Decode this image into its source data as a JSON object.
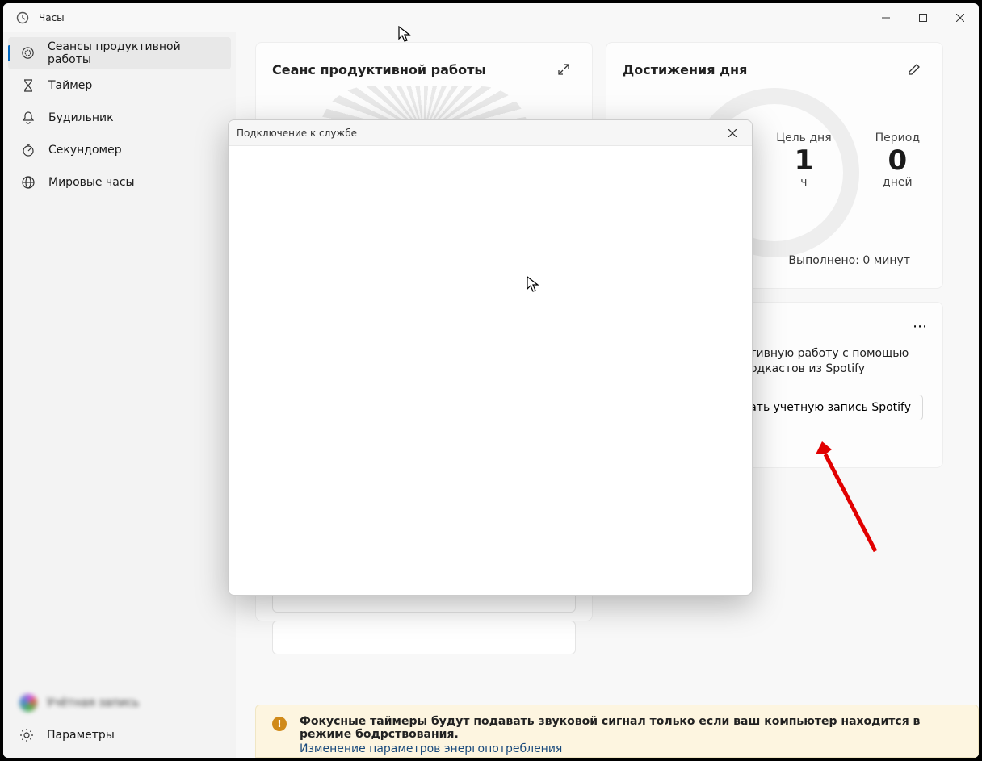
{
  "app": {
    "title": "Часы"
  },
  "nav": {
    "items": [
      {
        "label": "Сеансы продуктивной работы"
      },
      {
        "label": "Таймер"
      },
      {
        "label": "Будильник"
      },
      {
        "label": "Секундомер"
      },
      {
        "label": "Мировые часы"
      }
    ]
  },
  "account": {
    "name": "Учётная запись"
  },
  "settings": {
    "label": "Параметры"
  },
  "session": {
    "title": "Сеанс продуктивной работы"
  },
  "achieve": {
    "title": "Достижения дня",
    "goal": {
      "label": "Цель дня",
      "value": "1",
      "unit": "ч"
    },
    "streak": {
      "label": "Период",
      "value": "0",
      "unit": "дней"
    },
    "done": "Выполнено: 0 минут"
  },
  "spotify": {
    "text": "Настройте продуктивную работу с помощью музыки и подкастов из Spotify",
    "button": "Связать учетную запись Spotify"
  },
  "banner": {
    "title": "Фокусные таймеры будут подавать звуковой сигнал только если ваш компьютер находится в режиме бодрствования.",
    "link": "Изменение параметров энергопотребления"
  },
  "modal": {
    "title": "Подключение к службе"
  }
}
